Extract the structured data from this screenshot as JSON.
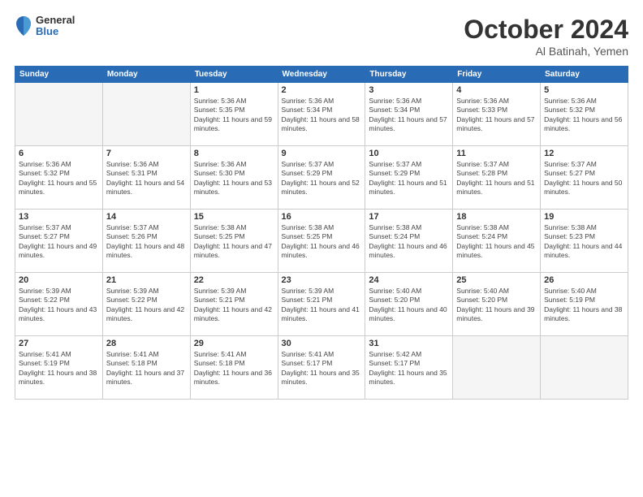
{
  "header": {
    "logo": {
      "general": "General",
      "blue": "Blue"
    },
    "title": "October 2024",
    "location": "Al Batinah, Yemen"
  },
  "calendar": {
    "days_of_week": [
      "Sunday",
      "Monday",
      "Tuesday",
      "Wednesday",
      "Thursday",
      "Friday",
      "Saturday"
    ],
    "weeks": [
      [
        {
          "day": "",
          "info": ""
        },
        {
          "day": "",
          "info": ""
        },
        {
          "day": "1",
          "info": "Sunrise: 5:36 AM\nSunset: 5:35 PM\nDaylight: 11 hours and 59 minutes."
        },
        {
          "day": "2",
          "info": "Sunrise: 5:36 AM\nSunset: 5:34 PM\nDaylight: 11 hours and 58 minutes."
        },
        {
          "day": "3",
          "info": "Sunrise: 5:36 AM\nSunset: 5:34 PM\nDaylight: 11 hours and 57 minutes."
        },
        {
          "day": "4",
          "info": "Sunrise: 5:36 AM\nSunset: 5:33 PM\nDaylight: 11 hours and 57 minutes."
        },
        {
          "day": "5",
          "info": "Sunrise: 5:36 AM\nSunset: 5:32 PM\nDaylight: 11 hours and 56 minutes."
        }
      ],
      [
        {
          "day": "6",
          "info": "Sunrise: 5:36 AM\nSunset: 5:32 PM\nDaylight: 11 hours and 55 minutes."
        },
        {
          "day": "7",
          "info": "Sunrise: 5:36 AM\nSunset: 5:31 PM\nDaylight: 11 hours and 54 minutes."
        },
        {
          "day": "8",
          "info": "Sunrise: 5:36 AM\nSunset: 5:30 PM\nDaylight: 11 hours and 53 minutes."
        },
        {
          "day": "9",
          "info": "Sunrise: 5:37 AM\nSunset: 5:29 PM\nDaylight: 11 hours and 52 minutes."
        },
        {
          "day": "10",
          "info": "Sunrise: 5:37 AM\nSunset: 5:29 PM\nDaylight: 11 hours and 51 minutes."
        },
        {
          "day": "11",
          "info": "Sunrise: 5:37 AM\nSunset: 5:28 PM\nDaylight: 11 hours and 51 minutes."
        },
        {
          "day": "12",
          "info": "Sunrise: 5:37 AM\nSunset: 5:27 PM\nDaylight: 11 hours and 50 minutes."
        }
      ],
      [
        {
          "day": "13",
          "info": "Sunrise: 5:37 AM\nSunset: 5:27 PM\nDaylight: 11 hours and 49 minutes."
        },
        {
          "day": "14",
          "info": "Sunrise: 5:37 AM\nSunset: 5:26 PM\nDaylight: 11 hours and 48 minutes."
        },
        {
          "day": "15",
          "info": "Sunrise: 5:38 AM\nSunset: 5:25 PM\nDaylight: 11 hours and 47 minutes."
        },
        {
          "day": "16",
          "info": "Sunrise: 5:38 AM\nSunset: 5:25 PM\nDaylight: 11 hours and 46 minutes."
        },
        {
          "day": "17",
          "info": "Sunrise: 5:38 AM\nSunset: 5:24 PM\nDaylight: 11 hours and 46 minutes."
        },
        {
          "day": "18",
          "info": "Sunrise: 5:38 AM\nSunset: 5:24 PM\nDaylight: 11 hours and 45 minutes."
        },
        {
          "day": "19",
          "info": "Sunrise: 5:38 AM\nSunset: 5:23 PM\nDaylight: 11 hours and 44 minutes."
        }
      ],
      [
        {
          "day": "20",
          "info": "Sunrise: 5:39 AM\nSunset: 5:22 PM\nDaylight: 11 hours and 43 minutes."
        },
        {
          "day": "21",
          "info": "Sunrise: 5:39 AM\nSunset: 5:22 PM\nDaylight: 11 hours and 42 minutes."
        },
        {
          "day": "22",
          "info": "Sunrise: 5:39 AM\nSunset: 5:21 PM\nDaylight: 11 hours and 42 minutes."
        },
        {
          "day": "23",
          "info": "Sunrise: 5:39 AM\nSunset: 5:21 PM\nDaylight: 11 hours and 41 minutes."
        },
        {
          "day": "24",
          "info": "Sunrise: 5:40 AM\nSunset: 5:20 PM\nDaylight: 11 hours and 40 minutes."
        },
        {
          "day": "25",
          "info": "Sunrise: 5:40 AM\nSunset: 5:20 PM\nDaylight: 11 hours and 39 minutes."
        },
        {
          "day": "26",
          "info": "Sunrise: 5:40 AM\nSunset: 5:19 PM\nDaylight: 11 hours and 38 minutes."
        }
      ],
      [
        {
          "day": "27",
          "info": "Sunrise: 5:41 AM\nSunset: 5:19 PM\nDaylight: 11 hours and 38 minutes."
        },
        {
          "day": "28",
          "info": "Sunrise: 5:41 AM\nSunset: 5:18 PM\nDaylight: 11 hours and 37 minutes."
        },
        {
          "day": "29",
          "info": "Sunrise: 5:41 AM\nSunset: 5:18 PM\nDaylight: 11 hours and 36 minutes."
        },
        {
          "day": "30",
          "info": "Sunrise: 5:41 AM\nSunset: 5:17 PM\nDaylight: 11 hours and 35 minutes."
        },
        {
          "day": "31",
          "info": "Sunrise: 5:42 AM\nSunset: 5:17 PM\nDaylight: 11 hours and 35 minutes."
        },
        {
          "day": "",
          "info": ""
        },
        {
          "day": "",
          "info": ""
        }
      ]
    ]
  }
}
